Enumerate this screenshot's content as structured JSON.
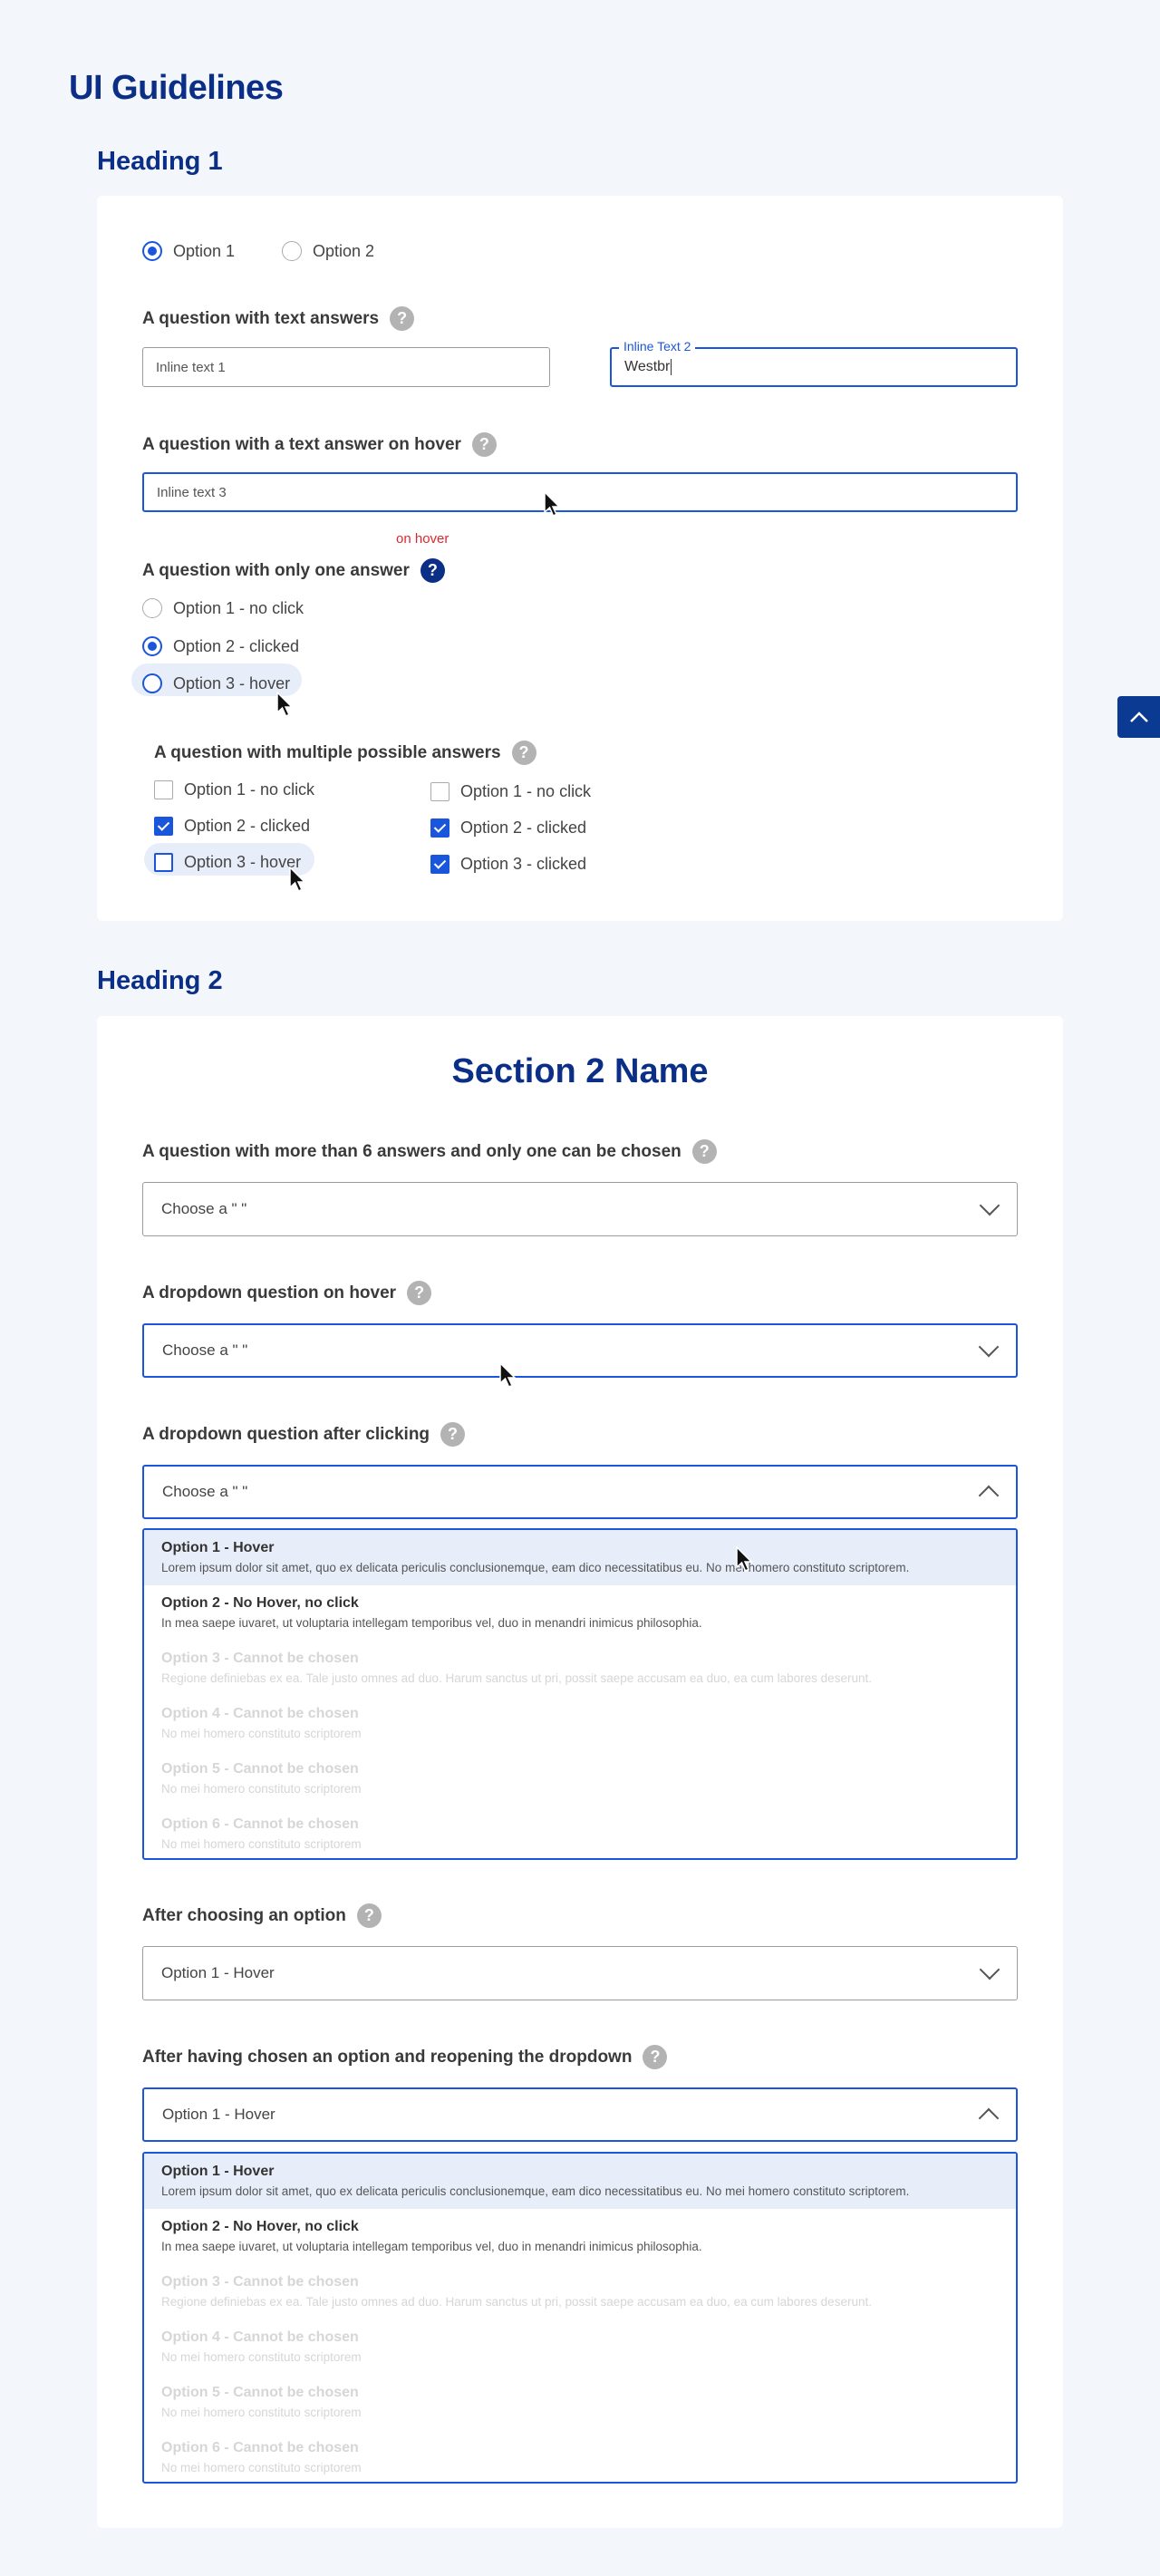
{
  "page": {
    "title": "UI Guidelines"
  },
  "headings": {
    "h1": "Heading 1",
    "h2": "Heading 2"
  },
  "section1": {
    "top_radios": [
      {
        "label": "Option 1",
        "checked": true
      },
      {
        "label": "Option 2",
        "checked": false
      }
    ],
    "text_answers": {
      "question": "A question with text answers",
      "input1_value": "Inline text 1",
      "input2_label": "Inline Text 2",
      "input2_value": "Westbr"
    },
    "hover_answer": {
      "question": "A question with a text answer on hover",
      "input_value": "Inline text 3",
      "hover_note": "on hover"
    },
    "single_answer": {
      "question": "A question with only one answer",
      "options": [
        "Option 1 - no click",
        "Option 2 - clicked",
        "Option 3 - hover"
      ]
    },
    "multi_answer": {
      "question": "A question with multiple possible answers",
      "col1": [
        "Option 1 - no click",
        "Option 2 - clicked",
        "Option 3 - hover"
      ],
      "col2": [
        "Option 1 - no click",
        "Option 2 - clicked",
        "Option 3 - clicked"
      ]
    }
  },
  "section2": {
    "name": "Section 2 Name",
    "q1": {
      "question": "A question with more than 6 answers and only one can be chosen",
      "value": "Choose a \"        \""
    },
    "q2": {
      "question": "A dropdown question on hover",
      "value": "Choose a \"        \""
    },
    "q3": {
      "question": "A dropdown question after clicking",
      "value": "Choose a \"        \""
    },
    "q4": {
      "question": "After choosing an option",
      "value": "Option 1 - Hover"
    },
    "q5": {
      "question": "After having chosen an option and reopening the dropdown",
      "value": "Option 1 - Hover"
    },
    "options": [
      {
        "title": "Option 1 - Hover",
        "desc": "Lorem ipsum dolor sit amet, quo ex delicata periculis conclusionemque, eam dico necessitatibus eu.  No mei homero constituto scriptorem."
      },
      {
        "title": "Option 2 - No Hover, no click",
        "desc": "In mea saepe iuvaret, ut voluptaria intellegam temporibus vel, duo in menandri inimicus philosophia."
      },
      {
        "title": "Option 3 - Cannot be chosen",
        "desc": "Regione definiebas ex ea. Tale justo omnes ad duo. Harum sanctus ut pri, possit saepe accusam ea duo, ea cum labores deserunt."
      },
      {
        "title": "Option 4 - Cannot be chosen",
        "desc": "No mei homero constituto scriptorem"
      },
      {
        "title": "Option 5 - Cannot be chosen",
        "desc": "No mei homero constituto scriptorem"
      },
      {
        "title": "Option 6 - Cannot be chosen",
        "desc": "No mei homero constituto scriptorem"
      }
    ]
  },
  "colors": {
    "brand": "#0b2e87",
    "accent": "#1a56db",
    "hover_bg": "#e8eef9",
    "error": "#e0262b"
  }
}
